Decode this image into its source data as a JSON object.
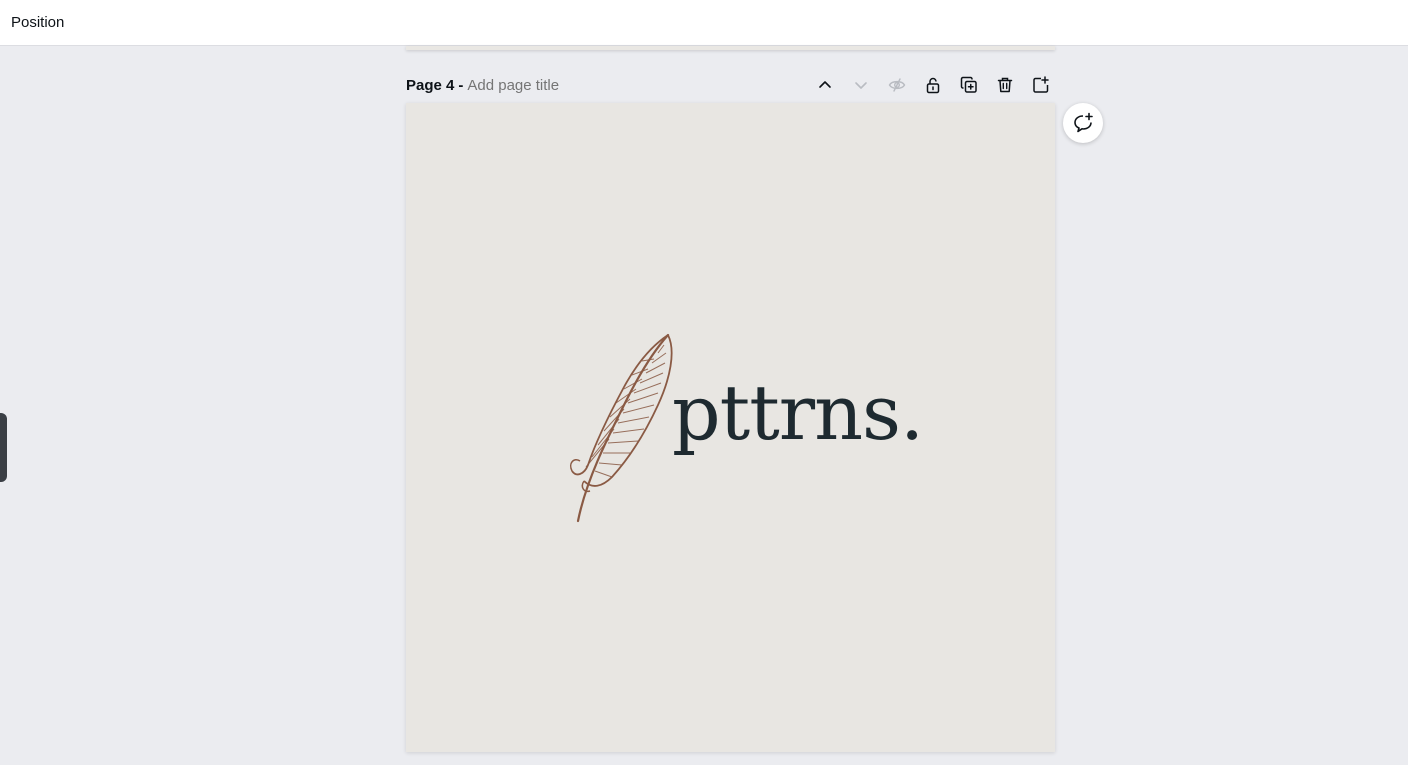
{
  "topbar": {
    "tab_label": "Position"
  },
  "page": {
    "number_label": "Page 4",
    "separator": "-",
    "title_placeholder": "Add page title"
  },
  "page_actions": [
    {
      "name": "move-page-up-button",
      "icon": "chevron-up-icon"
    },
    {
      "name": "move-page-down-button",
      "icon": "chevron-down-icon"
    },
    {
      "name": "hide-page-button",
      "icon": "eye-off-icon"
    },
    {
      "name": "lock-page-button",
      "icon": "lock-icon"
    },
    {
      "name": "duplicate-page-button",
      "icon": "duplicate-icon"
    },
    {
      "name": "delete-page-button",
      "icon": "trash-icon"
    },
    {
      "name": "add-page-button",
      "icon": "add-page-icon"
    }
  ],
  "canvas": {
    "logo_text": "pttrns.",
    "background_color": "#e8e6e2",
    "feather_color": "#8a5a44",
    "text_color": "#1e2a30"
  },
  "comment": {
    "icon": "add-comment-icon"
  }
}
